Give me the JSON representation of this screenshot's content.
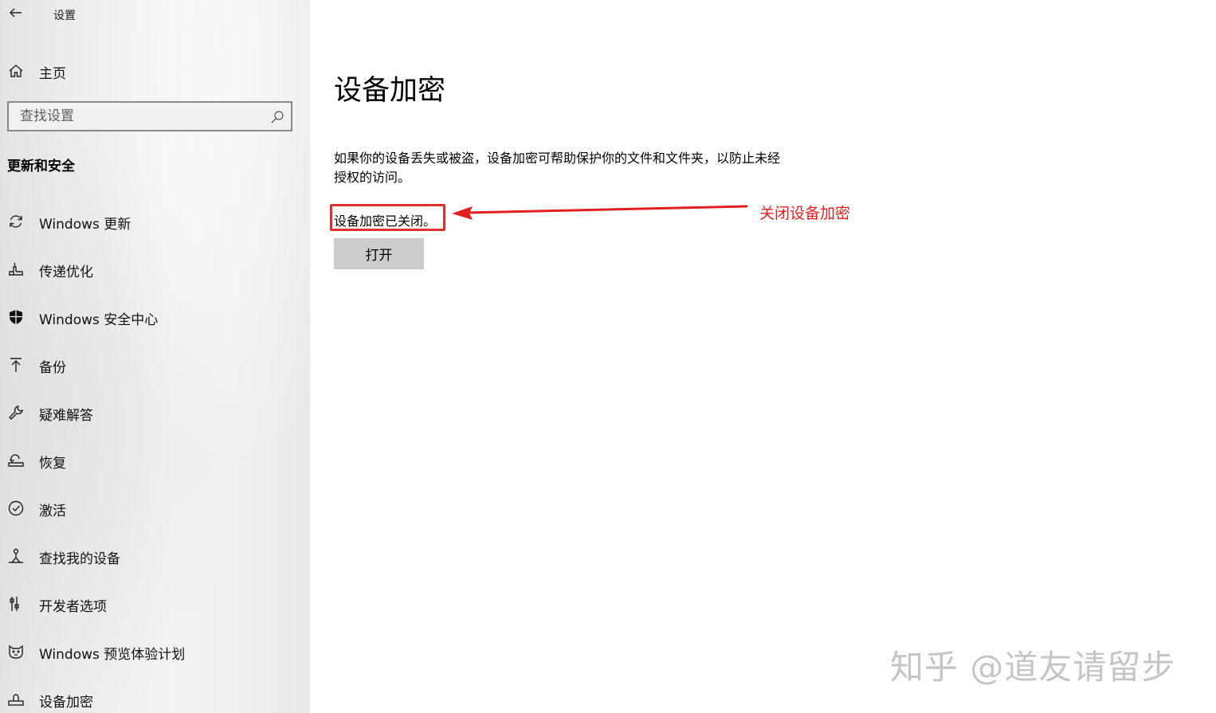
{
  "window": {
    "title": "设置"
  },
  "sidebar": {
    "home_label": "主页",
    "search": {
      "placeholder": "查找设置",
      "value": ""
    },
    "section_title": "更新和安全",
    "items": [
      {
        "label": "Windows 更新",
        "icon": "sync-icon"
      },
      {
        "label": "传递优化",
        "icon": "delivery-optimization-icon"
      },
      {
        "label": "Windows 安全中心",
        "icon": "shield-icon"
      },
      {
        "label": "备份",
        "icon": "backup-arrow-icon"
      },
      {
        "label": "疑难解答",
        "icon": "wrench-icon"
      },
      {
        "label": "恢复",
        "icon": "recovery-icon"
      },
      {
        "label": "激活",
        "icon": "check-circle-icon"
      },
      {
        "label": "查找我的设备",
        "icon": "find-device-icon"
      },
      {
        "label": "开发者选项",
        "icon": "developer-tools-icon"
      },
      {
        "label": "Windows 预览体验计划",
        "icon": "insider-cat-icon"
      },
      {
        "label": "设备加密",
        "icon": "device-encryption-icon"
      }
    ]
  },
  "main": {
    "title": "设备加密",
    "description": "如果你的设备丢失或被盗，设备加密可帮助保护你的文件和文件夹，以防止未经授权的访问。",
    "status": "设备加密已关闭。",
    "open_button_label": "打开"
  },
  "annotation": {
    "label": "关闭设备加密",
    "color": "#e02020"
  },
  "watermark": {
    "text": "知乎 @道友请留步"
  },
  "colors": {
    "sidebar_bg": "#ececec",
    "button_bg": "#cccccc",
    "highlight_red": "#e03030"
  }
}
